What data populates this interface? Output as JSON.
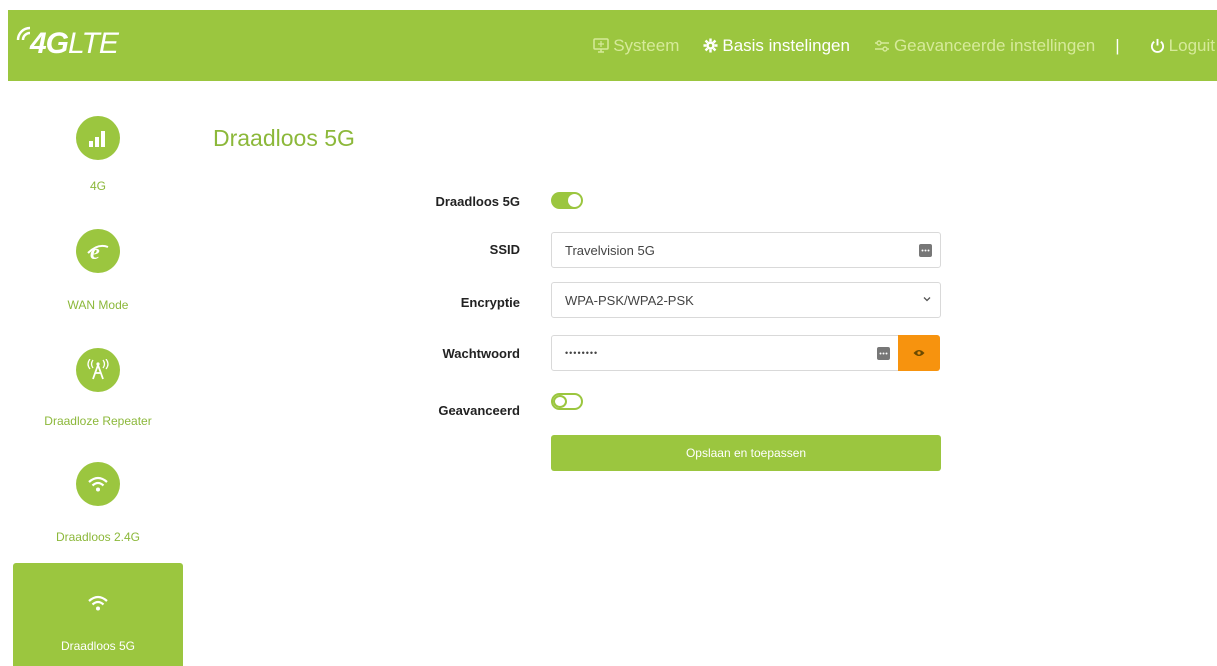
{
  "header": {
    "logo_text": "4G",
    "logo_text_lte": "LTE",
    "nav": {
      "system": "Systeem",
      "basic": "Basis instelingen",
      "advanced": "Geavanceerde instellingen",
      "separator": "|",
      "logout": "Loguit"
    }
  },
  "sidebar": {
    "items": [
      {
        "label": "4G",
        "icon": "signal-bars-icon"
      },
      {
        "label": "WAN Mode",
        "icon": "internet-e-icon"
      },
      {
        "label": "Draadloze Repeater",
        "icon": "antenna-icon"
      },
      {
        "label": "Draadloos 2.4G",
        "icon": "wifi-icon"
      },
      {
        "label": "Draadloos 5G",
        "icon": "wifi-icon",
        "active": true
      }
    ]
  },
  "main": {
    "title": "Draadloos 5G",
    "fields": {
      "wireless_label": "Draadloos 5G",
      "wireless_on": true,
      "ssid_label": "SSID",
      "ssid_value": "Travelvision 5G",
      "encryption_label": "Encryptie",
      "encryption_value": "WPA-PSK/WPA2-PSK",
      "password_label": "Wachtwoord",
      "password_value": "••••••••",
      "advanced_label": "Geavanceerd",
      "advanced_on": false
    },
    "save_button": "Opslaan en toepassen"
  },
  "colors": {
    "brand_green": "#9bc63f",
    "accent_orange": "#f7930e"
  }
}
